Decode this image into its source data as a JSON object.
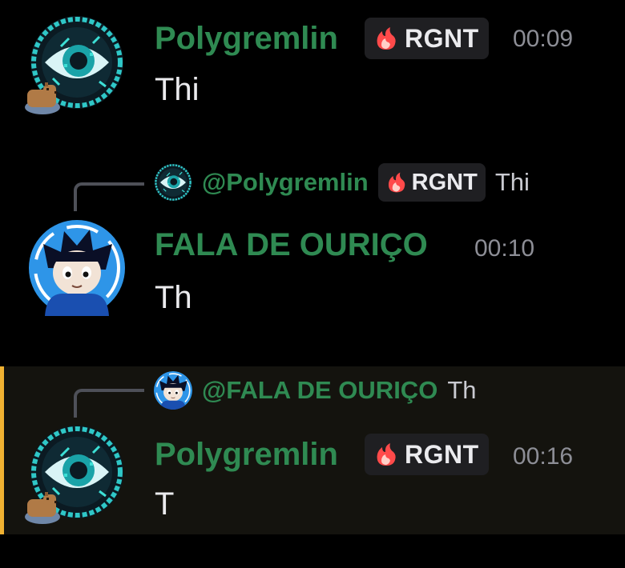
{
  "colors": {
    "background": "#000000",
    "username": "#2f8a52",
    "text": "#ebebee",
    "timestamp": "#8d8e96",
    "tag_bg": "#1f1f22",
    "highlight_bar": "#f0b232"
  },
  "messages": [
    {
      "author": "Polygremlin",
      "tag": "RGNT",
      "tag_icon": "flame-icon",
      "time": "00:09",
      "text": "Thi"
    },
    {
      "reply": {
        "author": "@Polygremlin",
        "tag": "RGNT",
        "text": "Thi"
      },
      "author": "FALA DE OURIÇO",
      "time": "00:10",
      "text": "Th"
    },
    {
      "reply": {
        "author": "@FALA DE OURIÇO",
        "text": "Th"
      },
      "author": "Polygremlin",
      "tag": "RGNT",
      "time": "00:16",
      "text": "T",
      "highlighted": true
    }
  ]
}
